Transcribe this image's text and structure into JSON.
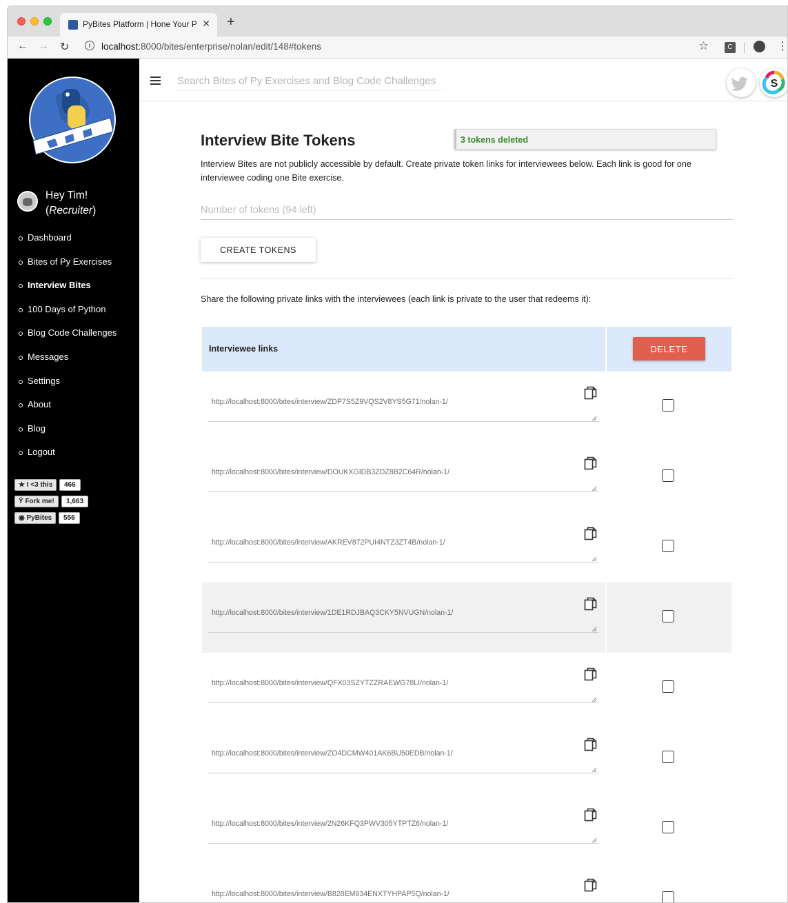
{
  "browser": {
    "tab_title": "PyBites Platform | Hone Your P",
    "url_host": "localhost",
    "url_rest": ":8000/bites/enterprise/nolan/edit/148#tokens"
  },
  "sidebar": {
    "greeting": "Hey Tim!",
    "role": "Recruiter",
    "nav": [
      {
        "label": "Dashboard"
      },
      {
        "label": "Bites of Py Exercises"
      },
      {
        "label": "Interview Bites",
        "active": true
      },
      {
        "label": "100 Days of Python"
      },
      {
        "label": "Blog Code Challenges"
      },
      {
        "label": "Messages"
      },
      {
        "label": "Settings"
      },
      {
        "label": "About"
      },
      {
        "label": "Blog"
      },
      {
        "label": "Logout"
      }
    ],
    "badges": [
      {
        "label": "★ I <3 this",
        "count": "466"
      },
      {
        "label": "Ÿ Fork me!",
        "count": "1,663"
      },
      {
        "label": "◉ PyBites",
        "count": "556"
      }
    ]
  },
  "header": {
    "search_placeholder": "Search Bites of Py Exercises and Blog Code Challenges"
  },
  "main": {
    "title": "Interview Bite Tokens",
    "toast": "3 tokens deleted",
    "intro": "Interview Bites are not publicly accessible by default. Create private token links for interviewees below. Each link is good for one interviewee coding one Bite exercise.",
    "tokens_placeholder": "Number of tokens (94 left)",
    "create_label": "CREATE TOKENS",
    "share_text": "Share the following private links with the interviewees (each link is private to the user that redeems it):",
    "table": {
      "header_links": "Interviewee links",
      "delete_label": "DELETE",
      "rows": [
        {
          "link": "http://localhost:8000/bites/interview/ZDP7S5Z9VQS2V8YS5G71/nolan-1/",
          "checked": false
        },
        {
          "link": "http://localhost:8000/bites/interview/DOUKXGIDB3ZDZ8B2C64R/nolan-1/",
          "checked": false
        },
        {
          "link": "http://localhost:8000/bites/interview/AKREV872PUI4NTZ3ZT4B/nolan-1/",
          "checked": false
        },
        {
          "link": "http://localhost:8000/bites/interview/1DE1RDJBAQ3CKY5NVUGN/nolan-1/",
          "checked": false,
          "highlighted": true
        },
        {
          "link": "http://localhost:8000/bites/interview/QFX03SZYTZZRAEWG78LI/nolan-1/",
          "checked": false
        },
        {
          "link": "http://localhost:8000/bites/interview/ZO4DCMW401AK6BU50EDB/nolan-1/",
          "checked": false
        },
        {
          "link": "http://localhost:8000/bites/interview/2N26KFQ3PWV305YTPTZ6/nolan-1/",
          "checked": false
        },
        {
          "link": "http://localhost:8000/bites/interview/B828EM634ENXTYHPAP5Q/nolan-1/",
          "checked": false
        }
      ]
    }
  }
}
